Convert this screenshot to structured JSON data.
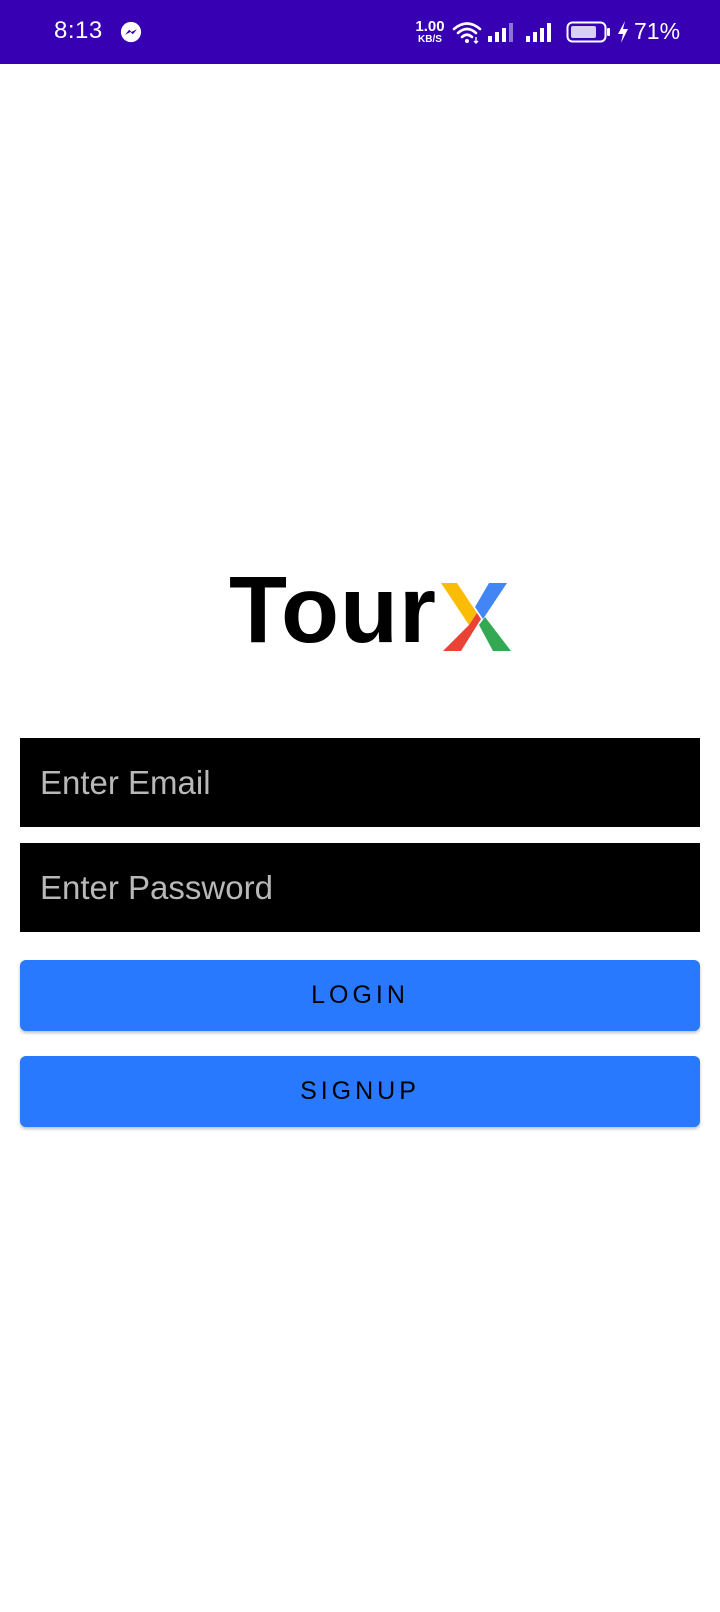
{
  "status_bar": {
    "time": "8:13",
    "net_speed_value": "1.00",
    "net_speed_unit": "KB/S",
    "battery_percent": "71%",
    "icons": [
      "messenger-icon",
      "wifi-icon",
      "signal-icon",
      "signal-icon",
      "battery-icon",
      "charging-icon"
    ],
    "background_color": "#3700b3"
  },
  "logo": {
    "text": "Tour",
    "x_icon_colors": [
      "#fbbc05",
      "#4285f4",
      "#ea4335",
      "#34a853"
    ]
  },
  "form": {
    "email_placeholder": "Enter Email",
    "email_value": "",
    "password_placeholder": "Enter Password",
    "password_value": ""
  },
  "buttons": {
    "login_label": "LOGIN",
    "signup_label": "SIGNUP",
    "color": "#2979ff"
  }
}
